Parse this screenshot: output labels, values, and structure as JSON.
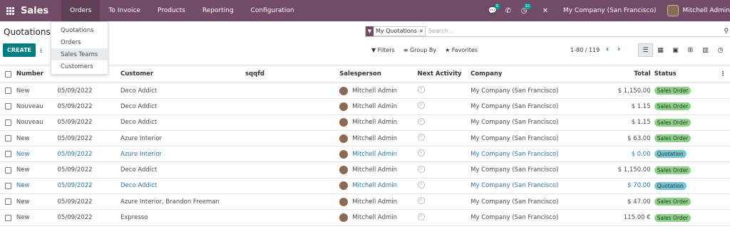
{
  "navbar": {
    "brand": "Sales",
    "menus": [
      "Orders",
      "To Invoice",
      "Products",
      "Reporting",
      "Configuration"
    ],
    "chat_badge": "5",
    "activity_badge": "32",
    "company": "My Company (San Francisco)",
    "user": "Mitchell Admin",
    "color": "#714b67"
  },
  "orders_menu": {
    "items": [
      "Quotations",
      "Orders",
      "Sales Teams",
      "Customers"
    ]
  },
  "control_panel": {
    "title": "Quotations",
    "create_label": "CREATE",
    "facet_label": "My Quotations",
    "search_placeholder": "Search...",
    "filters_label": "Filters",
    "groupby_label": "Group By",
    "favorites_label": "Favorites",
    "pager": "1-80 / 119"
  },
  "table": {
    "headers": {
      "number": "Number",
      "customer": "Customer",
      "sqqfd": "sqqfd",
      "salesperson": "Salesperson",
      "activity": "Next Activity",
      "company": "Company",
      "total": "Total",
      "status": "Status"
    },
    "rows": [
      {
        "number": "New",
        "date": "05/09/2022",
        "customer": "Deco Addict",
        "salesperson": "Mitchell Admin",
        "company": "My Company (San Francisco)",
        "total": "$ 1,150.00",
        "status": "Sales Order"
      },
      {
        "number": "Nouveau",
        "date": "05/09/2022",
        "customer": "Deco Addict",
        "salesperson": "Mitchell Admin",
        "company": "My Company (San Francisco)",
        "total": "$ 1.15",
        "status": "Sales Order"
      },
      {
        "number": "Nouveau",
        "date": "05/09/2022",
        "customer": "Deco Addict",
        "salesperson": "Mitchell Admin",
        "company": "My Company (San Francisco)",
        "total": "$ 1.15",
        "status": "Sales Order"
      },
      {
        "number": "New",
        "date": "05/09/2022",
        "customer": "Azure Interior",
        "salesperson": "Mitchell Admin",
        "company": "My Company (San Francisco)",
        "total": "$ 63.00",
        "status": "Sales Order"
      },
      {
        "number": "New",
        "date": "05/09/2022",
        "customer": "Azure Interior",
        "salesperson": "Mitchell Admin",
        "company": "My Company (San Francisco)",
        "total": "$ 0.00",
        "status": "Quotation"
      },
      {
        "number": "New",
        "date": "05/09/2022",
        "customer": "Deco Addict",
        "salesperson": "Mitchell Admin",
        "company": "My Company (San Francisco)",
        "total": "$ 1,150.00",
        "status": "Sales Order"
      },
      {
        "number": "New",
        "date": "05/09/2022",
        "customer": "Deco Addict",
        "salesperson": "Mitchell Admin",
        "company": "My Company (San Francisco)",
        "total": "$ 70.00",
        "status": "Quotation"
      },
      {
        "number": "New",
        "date": "05/09/2022",
        "customer": "Azure Interior, Brandon Freeman",
        "salesperson": "Mitchell Admin",
        "company": "My Company (San Francisco)",
        "total": "$ 47.00",
        "status": "Sales Order"
      },
      {
        "number": "New",
        "date": "05/09/2022",
        "customer": "Expresso",
        "salesperson": "Mitchell Admin",
        "company": "My Company (San Francisco)",
        "total": "115.00 €",
        "status": "Sales Order"
      }
    ]
  }
}
